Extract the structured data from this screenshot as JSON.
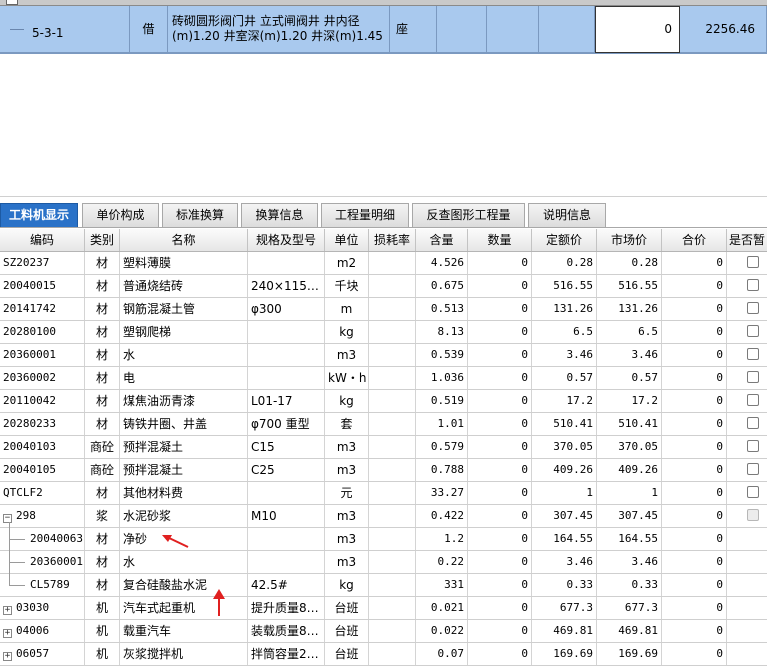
{
  "top_item": {
    "code": "5-3-1",
    "type": "借",
    "name_line1": "砖砌圆形阀门井 立式闸阀井 井内径",
    "name_line2": "(m)1.20 井室深(m)1.20 井深(m)1.45",
    "unit": "座",
    "quantity": "0",
    "price": "2256.46"
  },
  "tabs": [
    {
      "label": "工料机显示",
      "active": true
    },
    {
      "label": "单价构成",
      "active": false
    },
    {
      "label": "标准换算",
      "active": false
    },
    {
      "label": "换算信息",
      "active": false
    },
    {
      "label": "工程量明细",
      "active": false
    },
    {
      "label": "反查图形工程量",
      "active": false
    },
    {
      "label": "说明信息",
      "active": false
    }
  ],
  "columns": [
    "编码",
    "类别",
    "名称",
    "规格及型号",
    "单位",
    "损耗率",
    "含量",
    "数量",
    "定额价",
    "市场价",
    "合价",
    "是否暂"
  ],
  "rows": [
    {
      "code": "SZ20237",
      "type": "材",
      "name": "塑料薄膜",
      "spec": "",
      "unit": "m2",
      "content": "4.526",
      "qty": "0",
      "quota": "0.28",
      "market": "0.28",
      "total": "0"
    },
    {
      "code": "20040015",
      "type": "材",
      "name": "普通烧结砖",
      "spec": "240×115…",
      "unit": "千块",
      "content": "0.675",
      "qty": "0",
      "quota": "516.55",
      "market": "516.55",
      "total": "0"
    },
    {
      "code": "20141742",
      "type": "材",
      "name": "钢筋混凝土管",
      "spec": "φ300",
      "unit": "m",
      "content": "0.513",
      "qty": "0",
      "quota": "131.26",
      "market": "131.26",
      "total": "0"
    },
    {
      "code": "20280100",
      "type": "材",
      "name": "塑钢爬梯",
      "spec": "",
      "unit": "kg",
      "content": "8.13",
      "qty": "0",
      "quota": "6.5",
      "market": "6.5",
      "total": "0"
    },
    {
      "code": "20360001",
      "type": "材",
      "name": "水",
      "spec": "",
      "unit": "m3",
      "content": "0.539",
      "qty": "0",
      "quota": "3.46",
      "market": "3.46",
      "total": "0"
    },
    {
      "code": "20360002",
      "type": "材",
      "name": "电",
      "spec": "",
      "unit": "kW・h",
      "content": "1.036",
      "qty": "0",
      "quota": "0.57",
      "market": "0.57",
      "total": "0"
    },
    {
      "code": "20110042",
      "type": "材",
      "name": "煤焦油沥青漆",
      "spec": "L01-17",
      "unit": "kg",
      "content": "0.519",
      "qty": "0",
      "quota": "17.2",
      "market": "17.2",
      "total": "0"
    },
    {
      "code": "20280233",
      "type": "材",
      "name": "铸铁井圈、井盖",
      "spec": "φ700 重型",
      "unit": "套",
      "content": "1.01",
      "qty": "0",
      "quota": "510.41",
      "market": "510.41",
      "total": "0"
    },
    {
      "code": "20040103",
      "type": "商砼",
      "name": "预拌混凝土",
      "spec": "C15",
      "unit": "m3",
      "content": "0.579",
      "qty": "0",
      "quota": "370.05",
      "market": "370.05",
      "total": "0"
    },
    {
      "code": "20040105",
      "type": "商砼",
      "name": "预拌混凝土",
      "spec": "C25",
      "unit": "m3",
      "content": "0.788",
      "qty": "0",
      "quota": "409.26",
      "market": "409.26",
      "total": "0"
    },
    {
      "code": "QTCLF2",
      "type": "材",
      "name": "其他材料费",
      "spec": "",
      "unit": "元",
      "content": "33.27",
      "qty": "0",
      "quota": "1",
      "market": "1",
      "total": "0"
    },
    {
      "code": "298",
      "type": "浆",
      "name": "水泥砂浆",
      "spec": "M10",
      "unit": "m3",
      "content": "0.422",
      "qty": "0",
      "quota": "307.45",
      "market": "307.45",
      "total": "0"
    },
    {
      "code": "20040063",
      "type": "材",
      "name": "净砂",
      "spec": "",
      "unit": "m3",
      "content": "1.2",
      "qty": "0",
      "quota": "164.55",
      "market": "164.55",
      "total": "0"
    },
    {
      "code": "20360001",
      "type": "材",
      "name": "水",
      "spec": "",
      "unit": "m3",
      "content": "0.22",
      "qty": "0",
      "quota": "3.46",
      "market": "3.46",
      "total": "0"
    },
    {
      "code": "CL5789",
      "type": "材",
      "name": "复合硅酸盐水泥",
      "spec": "42.5#",
      "unit": "kg",
      "content": "331",
      "qty": "0",
      "quota": "0.33",
      "market": "0.33",
      "total": "0"
    },
    {
      "code": "03030",
      "type": "机",
      "name": "汽车式起重机",
      "spec": "提升质量8…",
      "unit": "台班",
      "content": "0.021",
      "qty": "0",
      "quota": "677.3",
      "market": "677.3",
      "total": "0"
    },
    {
      "code": "04006",
      "type": "机",
      "name": "载重汽车",
      "spec": "装载质量8…",
      "unit": "台班",
      "content": "0.022",
      "qty": "0",
      "quota": "469.81",
      "market": "469.81",
      "total": "0"
    },
    {
      "code": "06057",
      "type": "机",
      "name": "灰浆搅拌机",
      "spec": "拌筒容量2…",
      "unit": "台班",
      "content": "0.07",
      "qty": "0",
      "quota": "169.69",
      "market": "169.69",
      "total": "0"
    }
  ],
  "colors": {
    "active_tab": "#2a72c8",
    "selected_row": "#a9c9ee",
    "arrow": "#e02020"
  }
}
